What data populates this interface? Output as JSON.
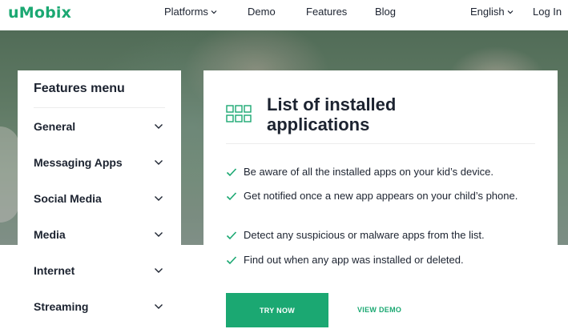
{
  "header": {
    "logo": "uMobix",
    "nav": [
      {
        "label": "Platforms",
        "has_dropdown": true
      },
      {
        "label": "Demo",
        "has_dropdown": false
      },
      {
        "label": "Features",
        "has_dropdown": false
      },
      {
        "label": "Blog",
        "has_dropdown": false
      }
    ],
    "language": "English",
    "login": "Log In"
  },
  "sidebar": {
    "title": "Features menu",
    "items": [
      {
        "label": "General"
      },
      {
        "label": "Messaging Apps"
      },
      {
        "label": "Social Media"
      },
      {
        "label": "Media"
      },
      {
        "label": "Internet"
      },
      {
        "label": "Streaming"
      }
    ]
  },
  "main": {
    "title": "List of installed applications",
    "icon": "grid-icon",
    "features": [
      "Be aware of all the installed apps on your kid’s device.",
      "Get notified once a new app appears on your child’s phone.",
      "Detect any suspicious or malware apps from the list.",
      "Find out when any app was installed or deleted."
    ],
    "try_button": "TRY NOW",
    "demo_link": "VIEW DEMO"
  },
  "colors": {
    "accent": "#1ba872",
    "text": "#1c2330"
  }
}
